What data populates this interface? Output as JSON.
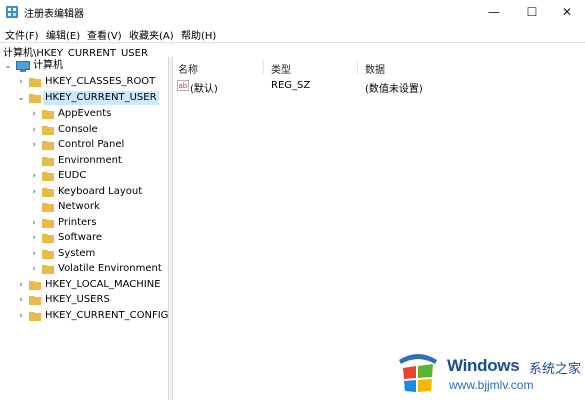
{
  "window": {
    "title": "注册表编辑器",
    "controls": {
      "minimize": "—",
      "maximize": "☐",
      "close": "✕"
    }
  },
  "menu": [
    "文件(F)",
    "编辑(E)",
    "查看(V)",
    "收藏夹(A)",
    "帮助(H)"
  ],
  "address": "计算机\\HKEY_CURRENT_USER",
  "tree": {
    "root": "计算机",
    "hives": [
      {
        "label": "HKEY_CLASSES_ROOT",
        "expanded": false,
        "selected": false
      },
      {
        "label": "HKEY_CURRENT_USER",
        "expanded": true,
        "selected": true,
        "children": [
          {
            "label": "AppEvents",
            "has_children": true
          },
          {
            "label": "Console",
            "has_children": true
          },
          {
            "label": "Control Panel",
            "has_children": true
          },
          {
            "label": "Environment",
            "has_children": false
          },
          {
            "label": "EUDC",
            "has_children": true
          },
          {
            "label": "Keyboard Layout",
            "has_children": true
          },
          {
            "label": "Network",
            "has_children": false
          },
          {
            "label": "Printers",
            "has_children": true
          },
          {
            "label": "Software",
            "has_children": true
          },
          {
            "label": "System",
            "has_children": true
          },
          {
            "label": "Volatile Environment",
            "has_children": true
          }
        ]
      },
      {
        "label": "HKEY_LOCAL_MACHINE",
        "expanded": false,
        "selected": false
      },
      {
        "label": "HKEY_USERS",
        "expanded": false,
        "selected": false
      },
      {
        "label": "HKEY_CURRENT_CONFIG",
        "expanded": false,
        "selected": false
      }
    ]
  },
  "list": {
    "columns": [
      "名称",
      "类型",
      "数据"
    ],
    "rows": [
      {
        "icon": "string-value-icon",
        "name": "(默认)",
        "type": "REG_SZ",
        "data": "(数值未设置)"
      }
    ]
  },
  "watermark": {
    "title": "Windows",
    "subtitle": "系统之家",
    "url": "www.bjjmlv.com"
  },
  "colors": {
    "folder": "#e9b949",
    "selection": "#cce8ff",
    "watermark_text": "#1b4f8c"
  }
}
